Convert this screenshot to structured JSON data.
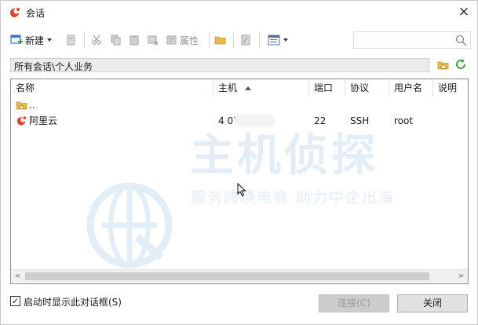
{
  "window": {
    "title": "会话",
    "close_glyph": "×"
  },
  "toolbar": {
    "new_label": "新建",
    "properties_label": "属性",
    "search_placeholder": ""
  },
  "path": {
    "text": "所有会话\\个人业务"
  },
  "columns": [
    {
      "label": "名称"
    },
    {
      "label": "主机"
    },
    {
      "label": "端口"
    },
    {
      "label": "协议"
    },
    {
      "label": "用户名"
    },
    {
      "label": "说明"
    }
  ],
  "rows": [
    {
      "name": "..",
      "icon": "folder-up-icon",
      "host": "",
      "port": "",
      "protocol": "",
      "user": "",
      "desc": ""
    },
    {
      "name": "阿里云",
      "icon": "session-icon",
      "host": "4          07",
      "port": "22",
      "protocol": "SSH",
      "user": "root",
      "desc": ""
    }
  ],
  "watermark": {
    "brand": "主机侦探",
    "tagline": "服务跨境电商 助力中企出海"
  },
  "footer": {
    "startup_checkbox_label": "启动时显示此对话框(S)",
    "startup_checked": true,
    "checkmark_glyph": "✓",
    "connect_label": "连接(C)",
    "close_label": "关闭"
  },
  "scroll_glyphs": {
    "left": "<",
    "right": ">"
  },
  "colors": {
    "accent_red": "#e0452f",
    "accent_blue": "#3a78c2",
    "folder_yellow": "#e8b84a",
    "refresh_green": "#3aa04a",
    "watermark": "#e3edf6"
  }
}
